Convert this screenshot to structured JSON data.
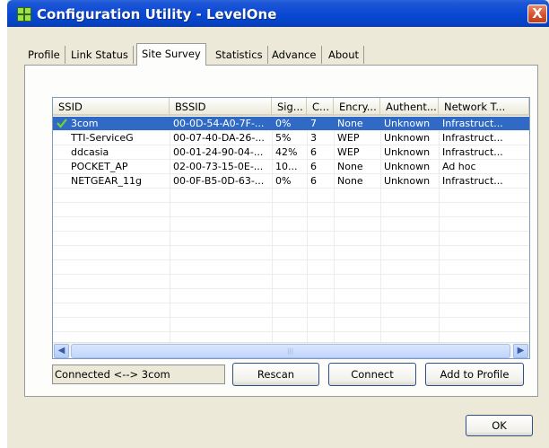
{
  "window": {
    "title": "Configuration Utility - LevelOne",
    "close_label": "X"
  },
  "tabs": [
    {
      "label": "Profile",
      "active": false
    },
    {
      "label": "Link Status",
      "active": false
    },
    {
      "label": "Site Survey",
      "active": true
    },
    {
      "label": "Statistics",
      "active": false
    },
    {
      "label": "Advance",
      "active": false
    },
    {
      "label": "About",
      "active": false
    }
  ],
  "survey_table": {
    "columns": [
      "SSID",
      "BSSID",
      "Sig...",
      "C...",
      "Encry...",
      "Authent...",
      "Network T..."
    ],
    "rows": [
      {
        "ssid": "3com",
        "bssid": "00-0D-54-A0-7F-...",
        "signal": "0%",
        "channel": "7",
        "encryption": "None",
        "authentication": "Unknown",
        "network_type": "Infrastruct...",
        "selected": true,
        "connected_icon": "check-icon"
      },
      {
        "ssid": "TTI-ServiceG",
        "bssid": "00-07-40-DA-26-...",
        "signal": "5%",
        "channel": "3",
        "encryption": "WEP",
        "authentication": "Unknown",
        "network_type": "Infrastruct..."
      },
      {
        "ssid": "ddcasia",
        "bssid": "00-01-24-90-04-...",
        "signal": "42%",
        "channel": "6",
        "encryption": "WEP",
        "authentication": "Unknown",
        "network_type": "Infrastruct..."
      },
      {
        "ssid": "POCKET_AP",
        "bssid": "02-00-73-15-0E-...",
        "signal": "10...",
        "channel": "6",
        "encryption": "None",
        "authentication": "Unknown",
        "network_type": "Ad hoc"
      },
      {
        "ssid": "NETGEAR_11g",
        "bssid": "00-0F-B5-0D-63-...",
        "signal": "0%",
        "channel": "6",
        "encryption": "None",
        "authentication": "Unknown",
        "network_type": "Infrastruct..."
      }
    ],
    "scroll_left_icon": "arrow-left-icon",
    "scroll_right_icon": "arrow-right-icon"
  },
  "status": {
    "text": "Connected <--> 3com"
  },
  "buttons": {
    "rescan": "Rescan",
    "connect": "Connect",
    "add_to_profile": "Add to Profile",
    "ok": "OK"
  },
  "colors": {
    "titlebar": "#0a49d4",
    "selection": "#316ac5",
    "dialog_bg": "#ece9d8"
  }
}
